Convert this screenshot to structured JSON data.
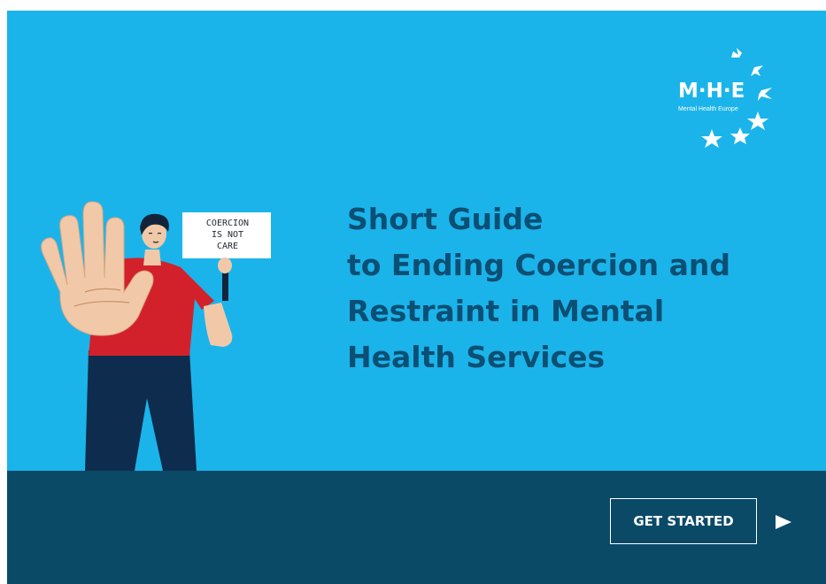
{
  "brand": {
    "logo_mark": "M·H·E",
    "logo_subtitle": "Mental Health Europe"
  },
  "hero": {
    "title_lines": [
      "Short Guide",
      "to Ending Coercion and",
      "Restraint in Mental",
      "Health Services"
    ],
    "sign_lines": [
      "COERCION",
      "IS NOT",
      "CARE"
    ]
  },
  "footer": {
    "cta_label": "GET STARTED",
    "next_icon": "play-triangle-icon"
  },
  "colors": {
    "hero_bg": "#1bb4ea",
    "footer_bg": "#0a4a67",
    "title": "#0b4f74",
    "shirt": "#d3212b",
    "pants": "#0e2c4d",
    "skin": "#f1c9a8"
  }
}
